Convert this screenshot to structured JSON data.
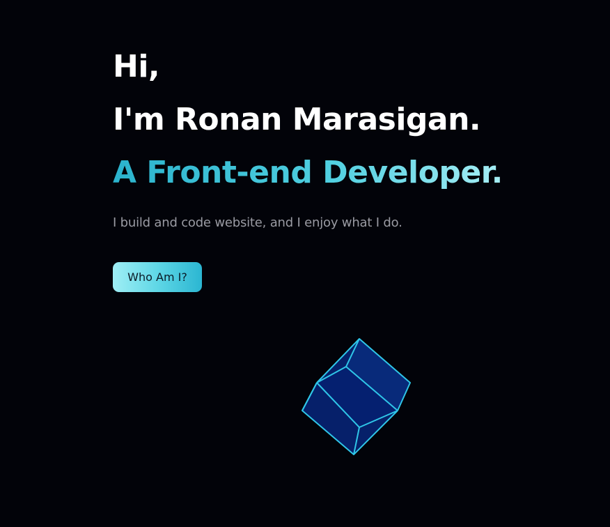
{
  "hero": {
    "greeting": "Hi,",
    "name_line": "I'm Ronan Marasigan.",
    "role_line": "A Front-end Developer.",
    "tagline": "I build and code website, and I enjoy what I do.",
    "cta_label": "Who Am I?"
  },
  "colors": {
    "background": "#020309",
    "accent": "#4fcfe0",
    "cube_fill": "#06206a",
    "cube_edge": "#2fc6e8"
  },
  "icons": {
    "cube": "wireframe-cube-icon"
  }
}
